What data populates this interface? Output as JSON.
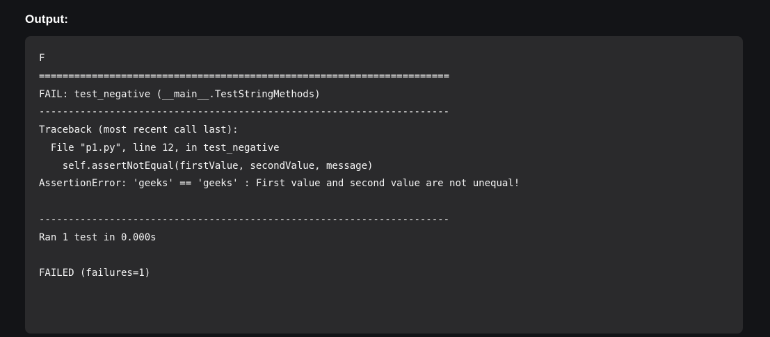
{
  "heading": "Output:",
  "output": {
    "lines": [
      "F",
      "======================================================================",
      "FAIL: test_negative (__main__.TestStringMethods)",
      "----------------------------------------------------------------------",
      "Traceback (most recent call last):",
      "  File \"p1.py\", line 12, in test_negative",
      "    self.assertNotEqual(firstValue, secondValue, message)",
      "AssertionError: 'geeks' == 'geeks' : First value and second value are not unequal!",
      "",
      "----------------------------------------------------------------------",
      "Ran 1 test in 0.000s",
      "",
      "FAILED (failures=1)"
    ]
  },
  "colors": {
    "page_background": "#131417",
    "panel_background": "#2a2a2c",
    "text": "#f4f4f4"
  }
}
